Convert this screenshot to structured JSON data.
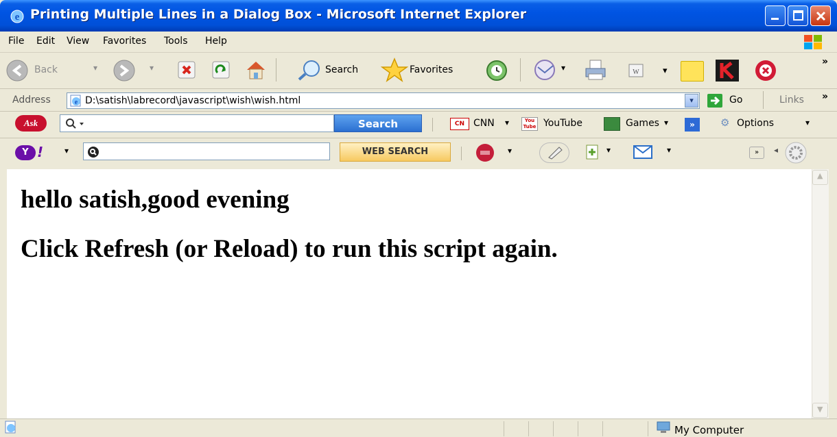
{
  "window": {
    "title": "Printing Multiple Lines in a Dialog Box - Microsoft Internet Explorer"
  },
  "menu": [
    "File",
    "Edit",
    "View",
    "Favorites",
    "Tools",
    "Help"
  ],
  "toolbar": {
    "back": "Back",
    "search": "Search",
    "favorites": "Favorites"
  },
  "address": {
    "label": "Address",
    "value": "D:\\satish\\labrecord\\javascript\\wish\\wish.html",
    "go": "Go",
    "links": "Links"
  },
  "ask_toolbar": {
    "search_button": "Search",
    "cnn": "CNN",
    "youtube": "YouTube",
    "games": "Games",
    "options": "Options"
  },
  "yahoo_toolbar": {
    "search_button": "WEB SEARCH"
  },
  "content": {
    "line1": "hello satish,good evening",
    "line2": "Click Refresh (or Reload) to run this script again."
  },
  "status": {
    "zone": "My Computer"
  },
  "colors": {
    "titlebar": "#0054e3",
    "chrome": "#ece9d8",
    "ask_search": "#2a6fd1",
    "yahoo_purple": "#6b0fa8"
  }
}
